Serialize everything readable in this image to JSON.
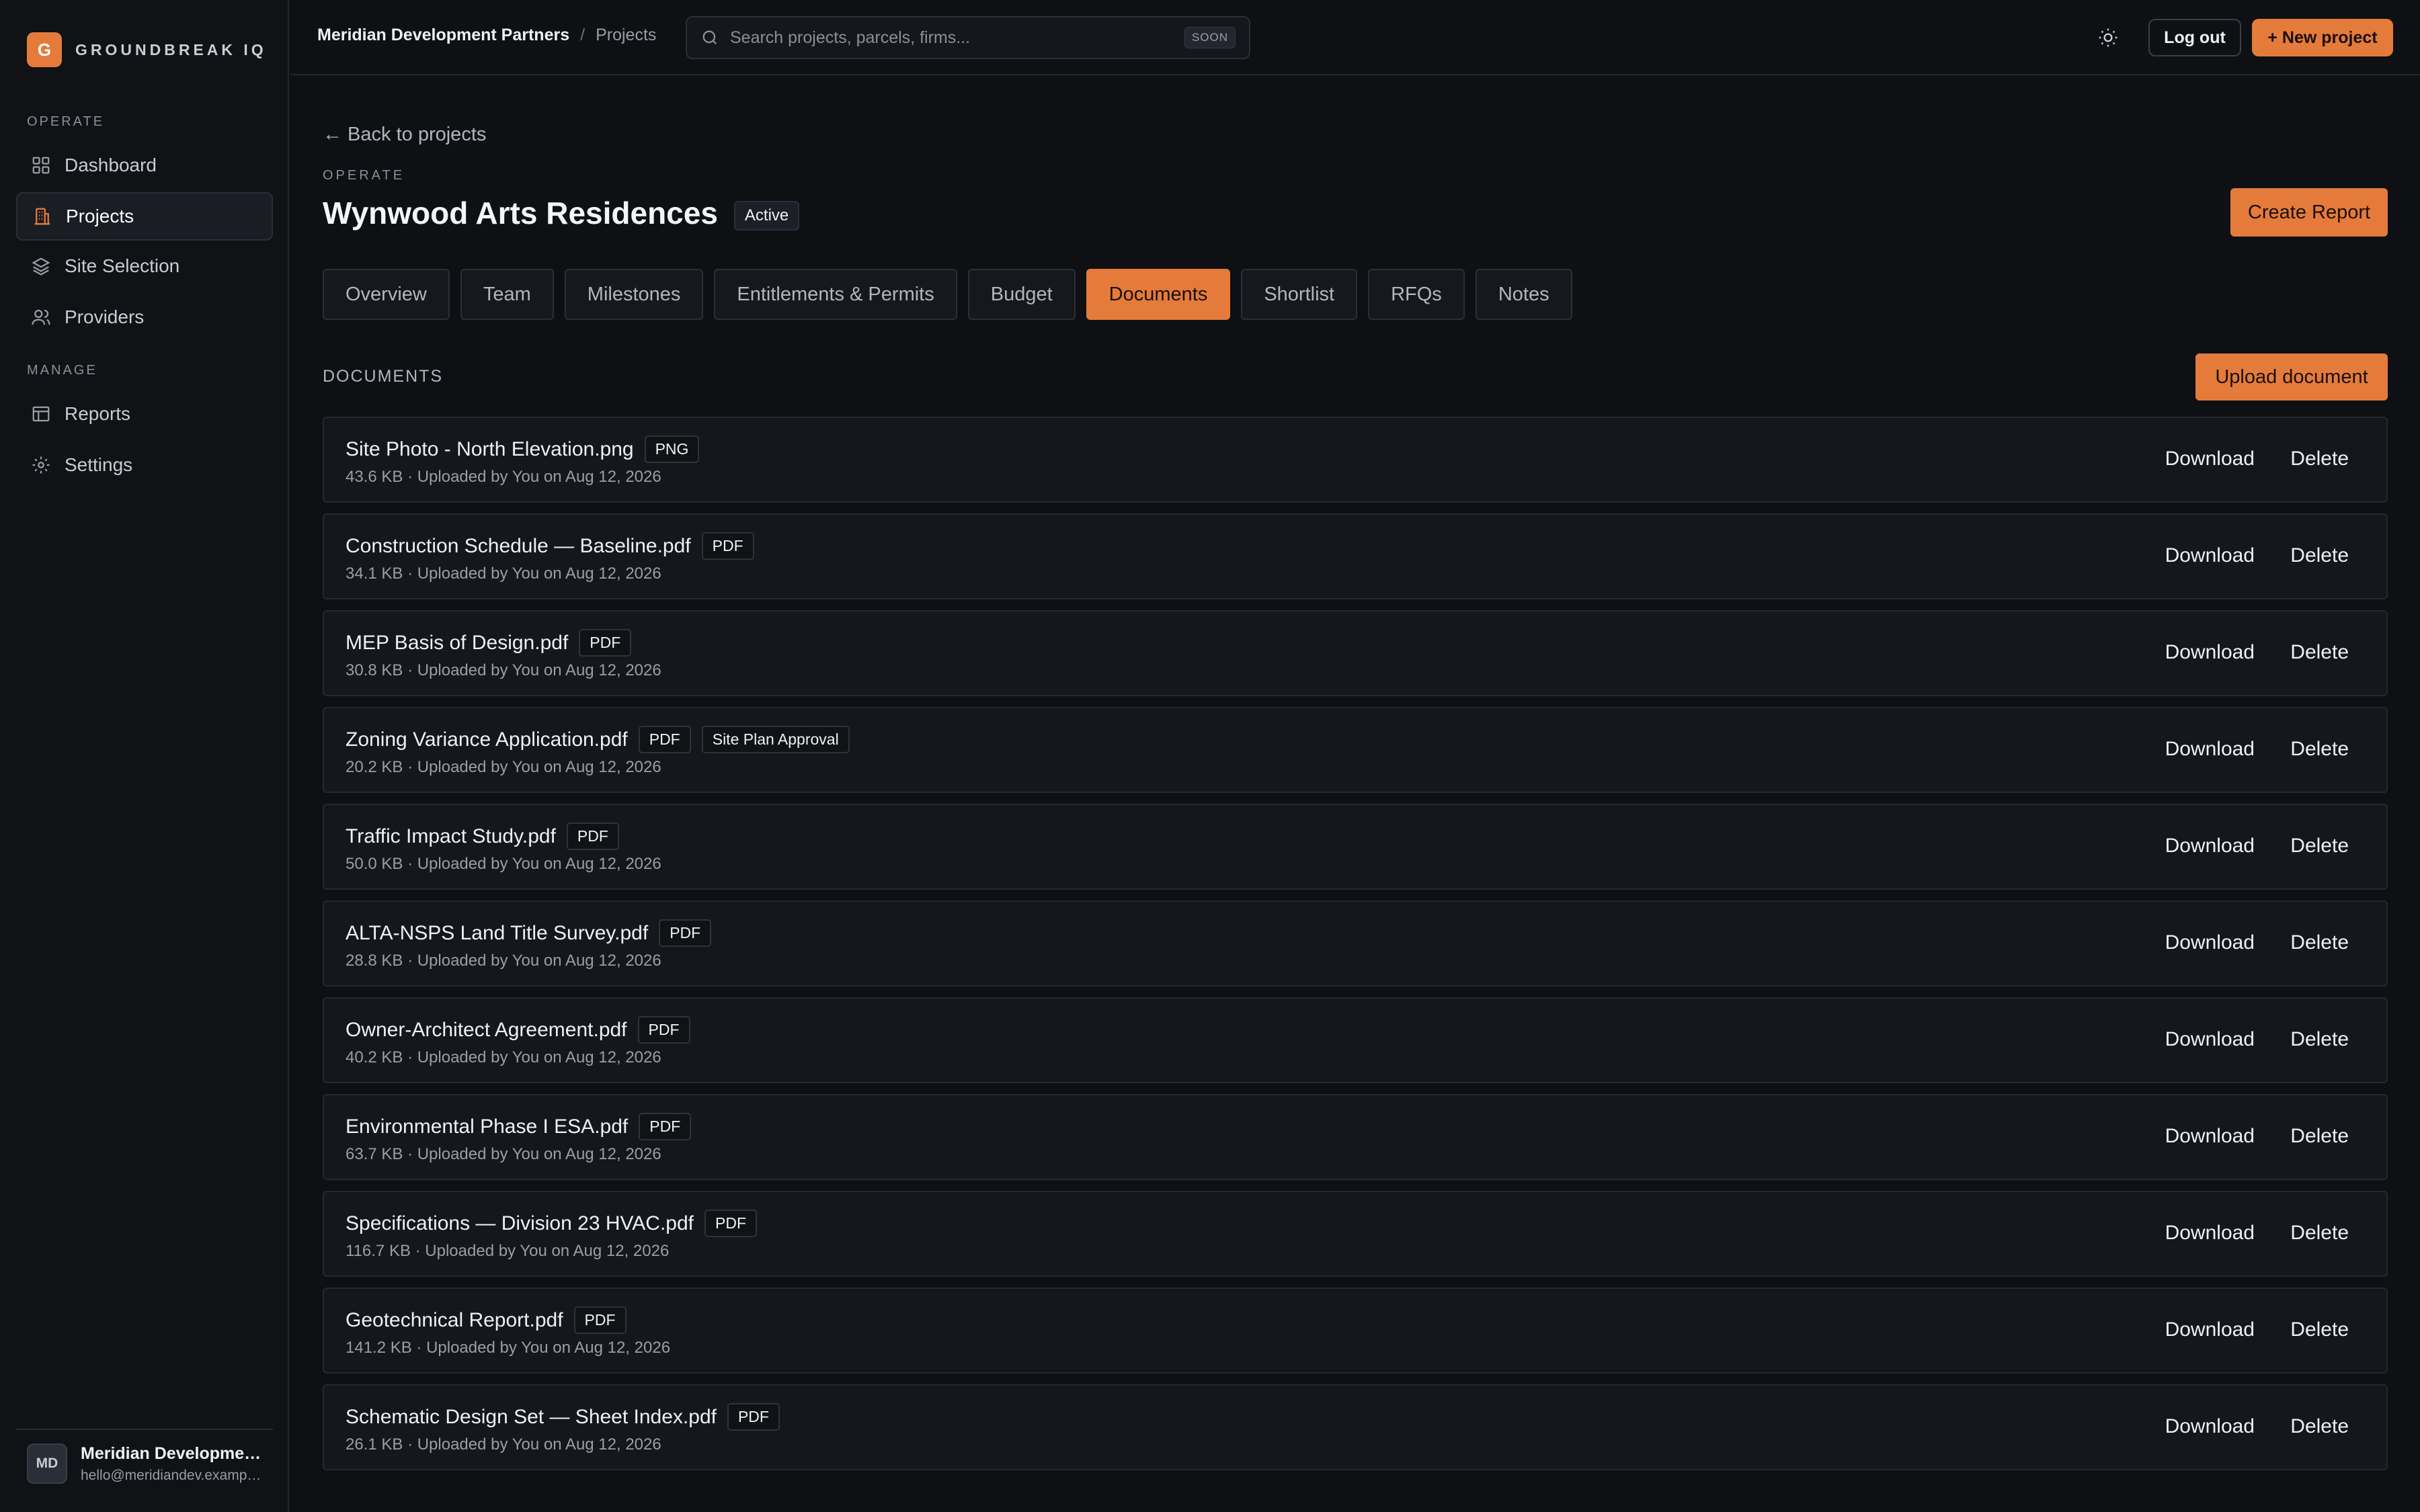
{
  "brand": {
    "logo_letter": "G",
    "name": "GROUNDBREAK IQ",
    "accent": "#e57b3b"
  },
  "sidebar": {
    "sections": [
      {
        "label": "OPERATE"
      },
      {
        "label": "MANAGE"
      }
    ],
    "items": [
      {
        "label": "Dashboard",
        "icon": "dashboard-icon"
      },
      {
        "label": "Projects",
        "icon": "building-icon",
        "active": true
      },
      {
        "label": "Site Selection",
        "icon": "layers-icon"
      },
      {
        "label": "Providers",
        "icon": "users-icon"
      },
      {
        "label": "Reports",
        "icon": "table-icon"
      },
      {
        "label": "Settings",
        "icon": "gear-icon"
      }
    ],
    "user": {
      "initials": "MD",
      "name": "Meridian Development Partners",
      "email": "hello@meridiandev.example.com"
    }
  },
  "topbar": {
    "breadcrumb": {
      "org": "Meridian Development Partners",
      "separator": "/",
      "page": "Projects"
    },
    "search": {
      "placeholder": "Search projects, parcels, firms...",
      "badge": "SOON"
    },
    "logout_label": "Log out",
    "new_project_label": "+ New project"
  },
  "project": {
    "back_label": "← Back to projects",
    "eyebrow": "OPERATE",
    "title": "Wynwood Arts Residences",
    "status": "Active",
    "create_report_label": "Create Report"
  },
  "tabs": [
    {
      "label": "Overview"
    },
    {
      "label": "Team"
    },
    {
      "label": "Milestones"
    },
    {
      "label": "Entitlements & Permits"
    },
    {
      "label": "Budget"
    },
    {
      "label": "Documents",
      "active": true
    },
    {
      "label": "Shortlist"
    },
    {
      "label": "RFQs"
    },
    {
      "label": "Notes"
    }
  ],
  "documents": {
    "heading": "DOCUMENTS",
    "upload_label": "Upload document",
    "download_label": "Download",
    "delete_label": "Delete",
    "items": [
      {
        "name": "Site Photo - North Elevation.png",
        "type": "PNG",
        "meta": "43.6 KB · Uploaded by You on Aug 12, 2026"
      },
      {
        "name": "Construction Schedule — Baseline.pdf",
        "type": "PDF",
        "meta": "34.1 KB · Uploaded by You on Aug 12, 2026"
      },
      {
        "name": "MEP Basis of Design.pdf",
        "type": "PDF",
        "meta": "30.8 KB · Uploaded by You on Aug 12, 2026"
      },
      {
        "name": "Zoning Variance Application.pdf",
        "type": "PDF",
        "tag": "Site Plan Approval",
        "meta": "20.2 KB · Uploaded by You on Aug 12, 2026"
      },
      {
        "name": "Traffic Impact Study.pdf",
        "type": "PDF",
        "meta": "50.0 KB · Uploaded by You on Aug 12, 2026"
      },
      {
        "name": "ALTA-NSPS Land Title Survey.pdf",
        "type": "PDF",
        "meta": "28.8 KB · Uploaded by You on Aug 12, 2026"
      },
      {
        "name": "Owner-Architect Agreement.pdf",
        "type": "PDF",
        "meta": "40.2 KB · Uploaded by You on Aug 12, 2026"
      },
      {
        "name": "Environmental Phase I ESA.pdf",
        "type": "PDF",
        "meta": "63.7 KB · Uploaded by You on Aug 12, 2026"
      },
      {
        "name": "Specifications — Division 23 HVAC.pdf",
        "type": "PDF",
        "meta": "116.7 KB · Uploaded by You on Aug 12, 2026"
      },
      {
        "name": "Geotechnical Report.pdf",
        "type": "PDF",
        "meta": "141.2 KB · Uploaded by You on Aug 12, 2026"
      },
      {
        "name": "Schematic Design Set — Sheet Index.pdf",
        "type": "PDF",
        "meta": "26.1 KB · Uploaded by You on Aug 12, 2026"
      }
    ]
  }
}
